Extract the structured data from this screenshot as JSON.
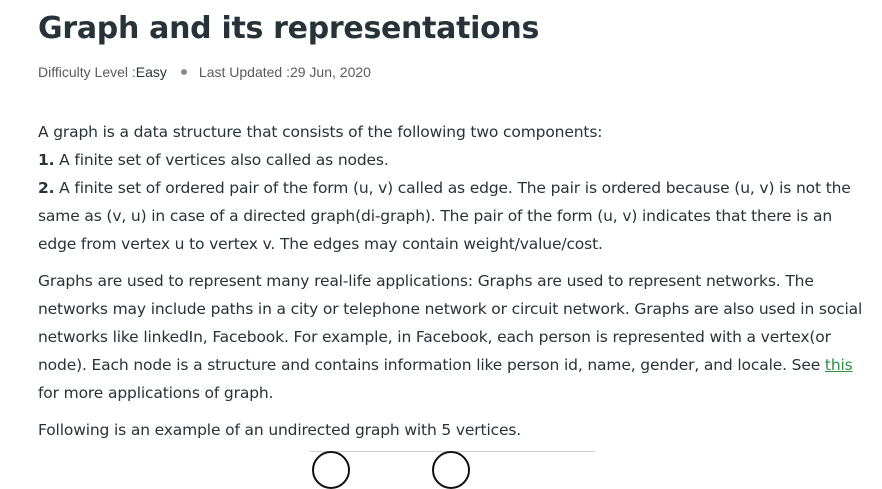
{
  "article": {
    "title": "Graph and its representations",
    "meta": {
      "difficulty_label": "Difficulty Level : ",
      "difficulty_value": "Easy",
      "updated_label": "Last Updated : ",
      "updated_value": "29 Jun, 2020"
    },
    "p1": {
      "intro": "A graph is a data structure that consists of the following two components:",
      "item1_num": "1.",
      "item1_text": " A finite set of vertices also called as nodes.",
      "item2_num": "2.",
      "item2_text": " A finite set of ordered pair of the form (u, v) called as edge. The pair is ordered because (u, v) is not the same as (v, u) in case of a directed graph(di-graph). The pair of the form (u, v) indicates that there is an edge from vertex u to vertex v. The edges may contain weight/value/cost."
    },
    "p2": {
      "text_before_link": "Graphs are used to represent many real-life applications: Graphs are used to represent networks. The networks may include paths in a city or telephone network or circuit network. Graphs are also used in social networks like linkedIn, Facebook. For example, in Facebook, each person is represented with a vertex(or node). Each node is a structure and contains information like person id, name, gender, and locale. See ",
      "link_text": "this",
      "text_after_link": " for more applications of graph."
    },
    "p3": {
      "text": "Following is an example of an undirected graph with 5 vertices."
    }
  },
  "colors": {
    "text": "#273239",
    "meta": "#5a5a5a",
    "link": "#2f8d46"
  }
}
